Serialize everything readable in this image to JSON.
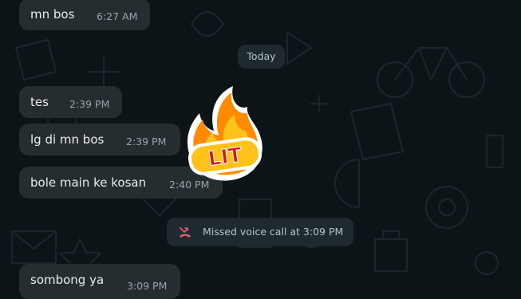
{
  "colors": {
    "background": "#0d1418",
    "bubble": "#262d31",
    "text": "#e9edef",
    "time": "#9aa5ab",
    "missed_call_icon": "#f15c6d",
    "sticker_text": "#d8141d"
  },
  "messages": [
    {
      "text": "mn bos",
      "time": "6:27 AM"
    },
    {
      "text": "tes",
      "time": "2:39 PM"
    },
    {
      "text": "lg di mn bos",
      "time": "2:39 PM"
    },
    {
      "text": "bole main ke kosan",
      "time": "2:40 PM"
    },
    {
      "text": "sombong ya",
      "time": "3:09 PM"
    }
  ],
  "date_divider": "Today",
  "missed_call": {
    "icon": "missed-call-icon",
    "text": "Missed voice call at 3:09 PM"
  },
  "sticker": {
    "icon": "fire-sticker",
    "text": "LIT"
  }
}
